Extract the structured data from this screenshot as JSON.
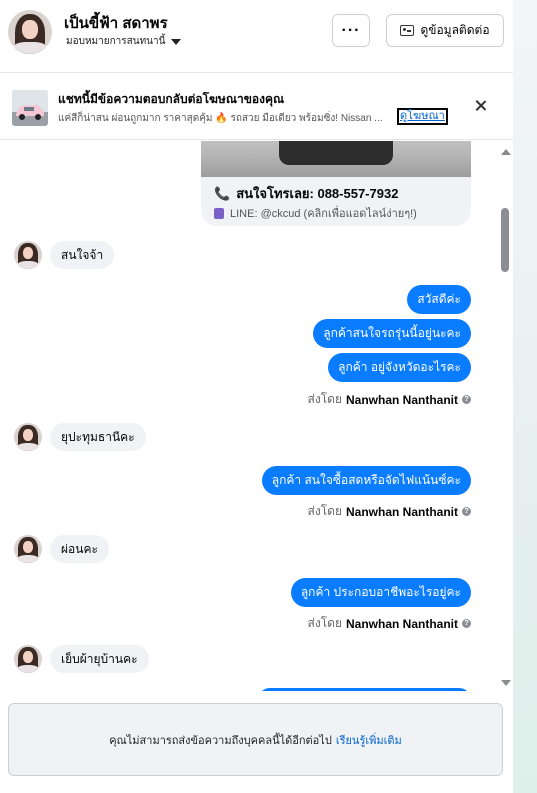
{
  "header": {
    "name": "เป็นขี้ฟ้า สดาพร",
    "assign_label": "มอบหมายการสนทนานี้",
    "more_label": "···",
    "contact_label": "ดูข้อมูลติดต่อ"
  },
  "ad_banner": {
    "title": "แชทนี้มีข้อความตอบกลับต่อโฆษณาของคุณ",
    "description": "แค่สีก็น่าสน ผ่อนถูกมาก ราคาสุดคุ้ม 🔥 รถสวย มือเดียว พร้อมซิ่ง! Nissan ...",
    "view_ad_label": "ดูโฆษณา"
  },
  "ad_card": {
    "phone_text": "สนใจโทรเลย: 088-557-7932",
    "line_text": "LINE: @ckcud (คลิกเพื่อแอดไลน์ง่ายๆ!)"
  },
  "messages": [
    {
      "from": "customer",
      "text": "สนใจจ้า"
    },
    {
      "from": "page",
      "text": "สวัสดีค่ะ"
    },
    {
      "from": "page",
      "text": "ลูกค้าสนใจรถรุ่นนี้อยู่นะคะ"
    },
    {
      "from": "page",
      "text": "ลูกค้า อยู่จังหวัดอะไรคะ"
    },
    {
      "from": "customer",
      "text": "ยุปะทุมธานีคะ"
    },
    {
      "from": "page",
      "text": "ลูกค้า สนใจซื้อสดหรือจัดไฟแน้นซ์คะ"
    },
    {
      "from": "customer",
      "text": "ผ่อนคะ"
    },
    {
      "from": "page",
      "text": "ลูกค้า ประกอบอาชีพอะไรอยู่คะ"
    },
    {
      "from": "customer",
      "text": "เย็บผ้ายุบ้านคะ"
    }
  ],
  "sent_by": {
    "prefix": "ส่งโดย",
    "name": "Nanwhan Nanthanit"
  },
  "footer": {
    "notice": "คุณไม่สามารถส่งข้อความถึงบุคคลนี้ได้อีกต่อไป",
    "learn_more": "เรียนรู้เพิ่มเติม"
  },
  "colors": {
    "outgoing_bubble": "#0a7cff",
    "incoming_bubble": "#f0f2f5",
    "link": "#0064d1"
  }
}
